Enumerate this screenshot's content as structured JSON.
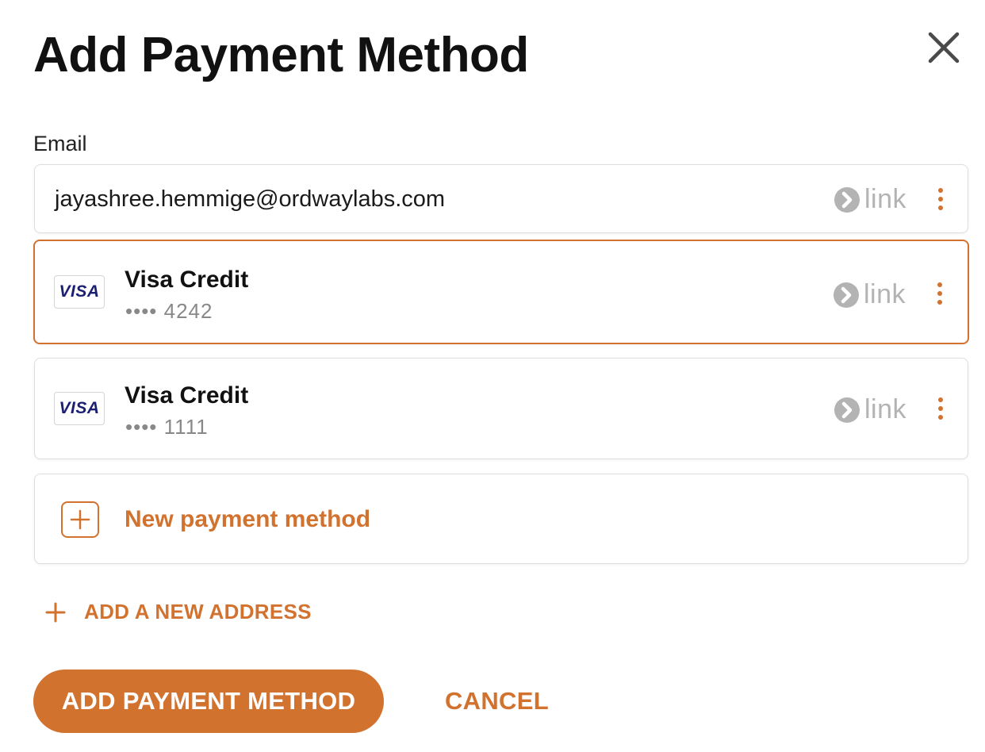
{
  "dialog": {
    "title": "Add Payment Method"
  },
  "email": {
    "label": "Email",
    "value": "jayashree.hemmige@ordwaylabs.com",
    "link_badge": "link"
  },
  "payment_methods": [
    {
      "brand": "VISA",
      "name": "Visa Credit",
      "masked_number": "•••• 4242",
      "link_badge": "link",
      "selected": true
    },
    {
      "brand": "VISA",
      "name": "Visa Credit",
      "masked_number": "•••• 1111",
      "link_badge": "link",
      "selected": false
    }
  ],
  "new_payment_method": {
    "label": "New payment method"
  },
  "add_address": {
    "label": "ADD A NEW ADDRESS"
  },
  "actions": {
    "primary_label": "ADD PAYMENT METHOD",
    "cancel_label": "CANCEL"
  },
  "colors": {
    "accent": "#d2722f",
    "link_gray": "#b3b3b3",
    "visa_blue": "#1a1f71"
  },
  "icons": {
    "close": "close-icon",
    "link": "link-chevron-icon",
    "menu": "kebab-menu-icon",
    "add": "plus-icon"
  }
}
